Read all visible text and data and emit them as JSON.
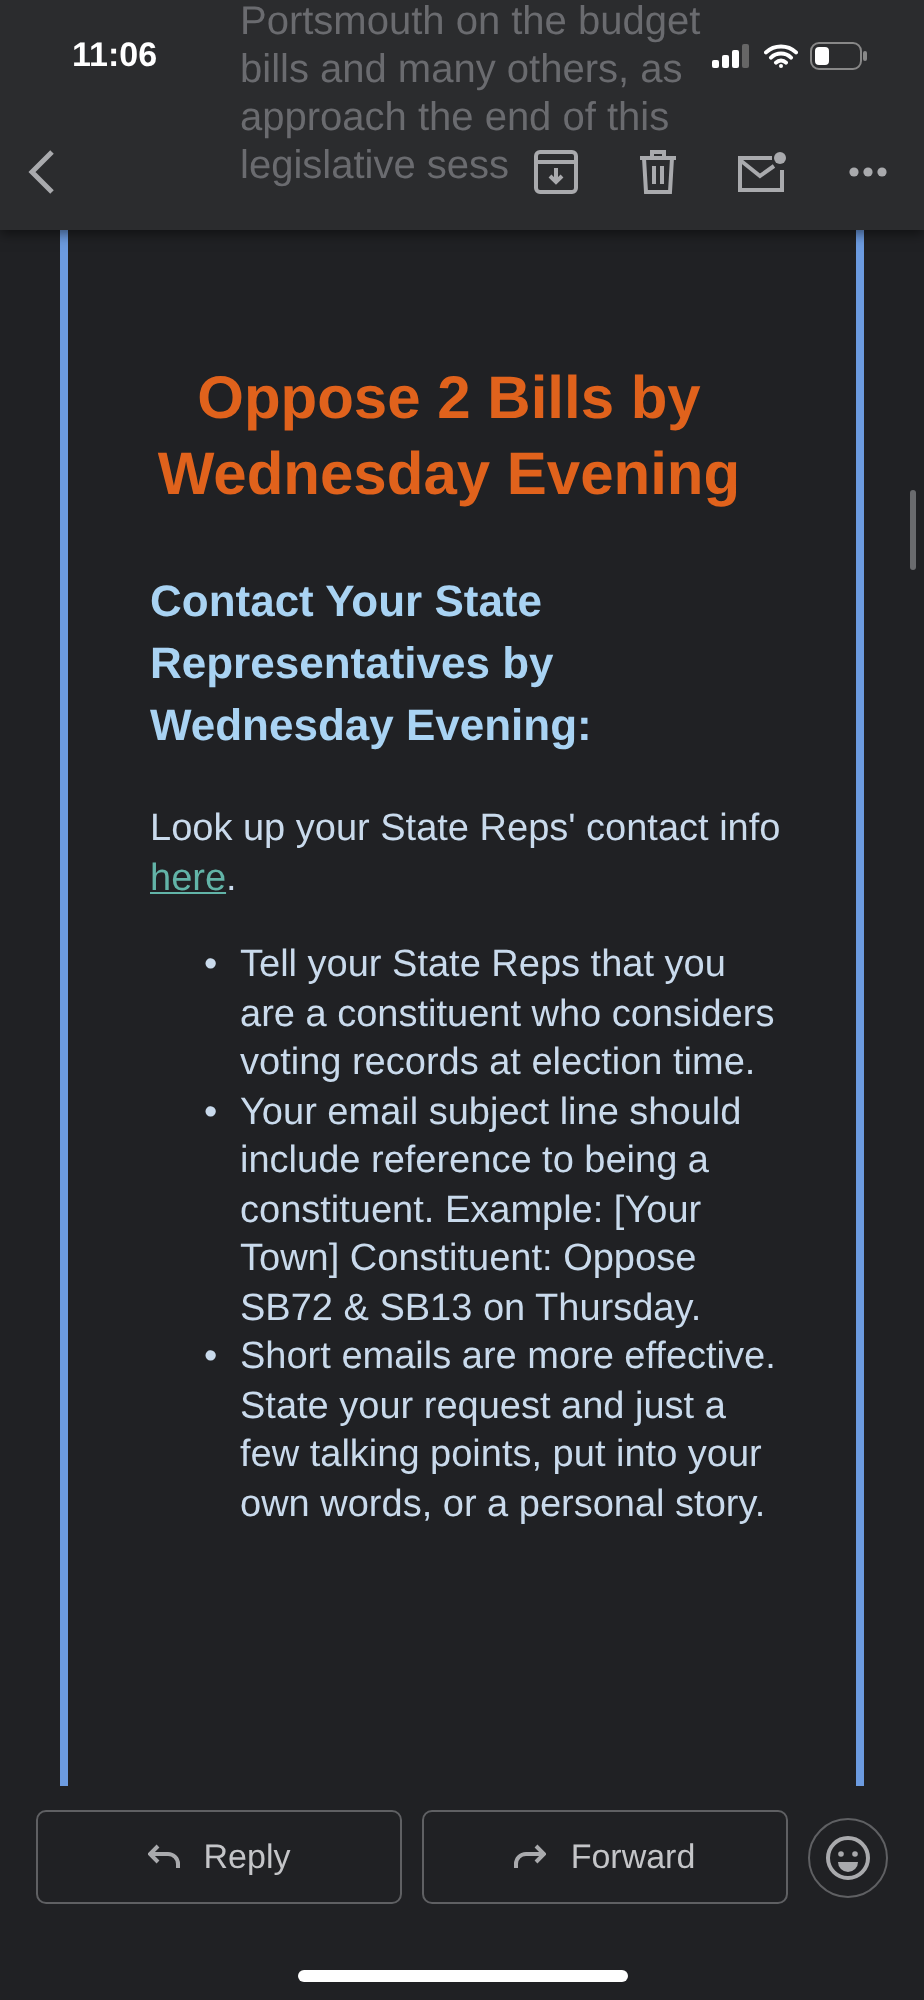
{
  "status_bar": {
    "time": "11:06"
  },
  "behind_text": [
    "Portsmouth on the budget",
    "bills and many others, as",
    "approach the end of this",
    "legislative sess"
  ],
  "email": {
    "title": "Oppose 2 Bills by Wednesday Evening",
    "heading": "Contact Your State Representatives by Wednesday Evening:",
    "intro": "Look up your State Reps' contact info ",
    "link": "here",
    "intro_end": ".",
    "bullets": [
      {
        "marker": "•",
        "text": "Tell your State Reps that you are a constituent who considers voting records at election time."
      },
      {
        "marker": "•",
        "text": "Your email subject line should include reference to being a constituent. Example: [Your Town] Constituent: Oppose SB72 & SB13 on Thursday."
      },
      {
        "marker": "•",
        "text": "Short emails are more effective. State your request and just a few talking points, put into your own words, or a personal story."
      }
    ]
  },
  "actions": [
    {
      "kind": "reply",
      "label": "Reply"
    },
    {
      "kind": "forward",
      "label": "Forward"
    }
  ]
}
